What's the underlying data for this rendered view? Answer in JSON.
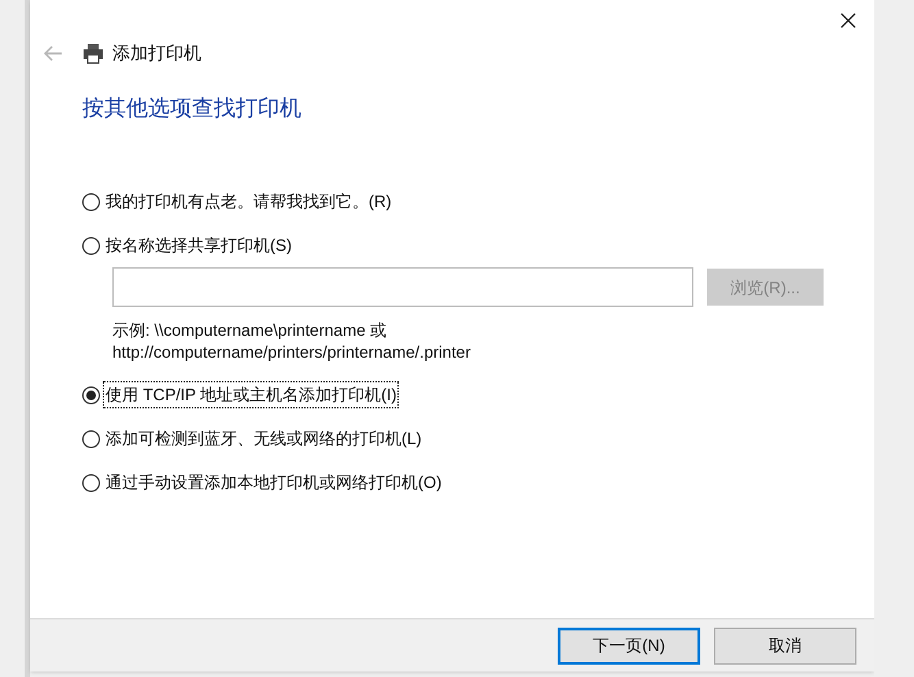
{
  "window": {
    "title": "添加打印机"
  },
  "heading": "按其他选项查找打印机",
  "options": [
    {
      "label": "我的打印机有点老。请帮我找到它。(R)",
      "selected": false
    },
    {
      "label": "按名称选择共享打印机(S)",
      "selected": false
    },
    {
      "label": "使用 TCP/IP 地址或主机名添加打印机(I)",
      "selected": true
    },
    {
      "label": "添加可检测到蓝牙、无线或网络的打印机(L)",
      "selected": false
    },
    {
      "label": "通过手动设置添加本地打印机或网络打印机(O)",
      "selected": false
    }
  ],
  "share_name": {
    "browse_button": {
      "label": "浏览(R)...",
      "disabled": true
    },
    "example_lines": [
      "示例: \\\\computername\\printername 或",
      "http://computername/printers/printername/.printer"
    ]
  },
  "buttons": [
    {
      "label": "下一页(N)",
      "default": true
    },
    {
      "label": "取消",
      "default": false
    }
  ]
}
